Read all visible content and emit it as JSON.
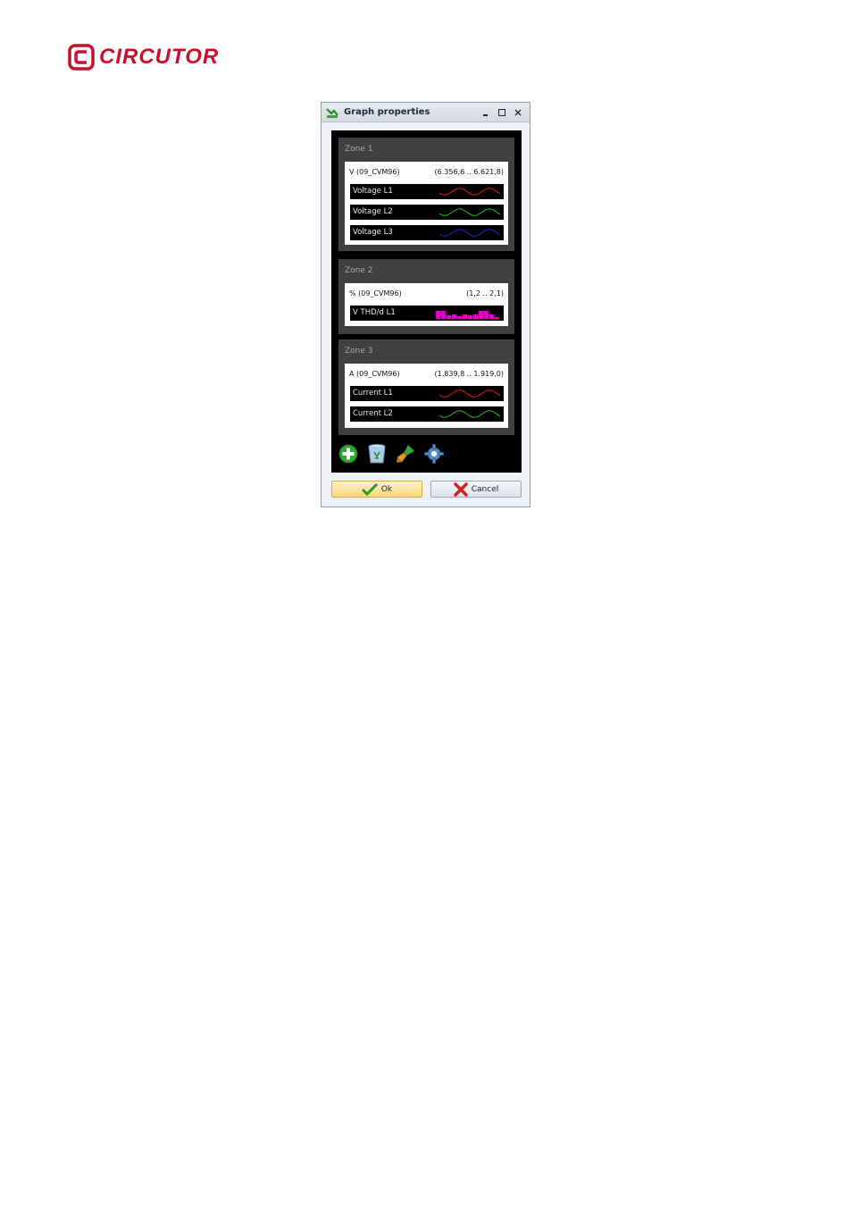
{
  "brand": {
    "name": "CIRCUTOR",
    "color": "#c8102e"
  },
  "window": {
    "title": "Graph properties",
    "minimize_icon": "minimize-icon",
    "maximize_icon": "maximize-icon",
    "close_icon": "close-icon"
  },
  "zones": [
    {
      "label": "Zone 1",
      "unit": "V (09_CVM96)",
      "range": "(6.356,6 .. 6.621,8)",
      "series": [
        {
          "name": "Voltage L1",
          "color": "#e02020",
          "style": "wave"
        },
        {
          "name": "Voltage L2",
          "color": "#20c020",
          "style": "wave"
        },
        {
          "name": "Voltage L3",
          "color": "#2020d0",
          "style": "wave"
        }
      ]
    },
    {
      "label": "Zone 2",
      "unit": "% (09_CVM96)",
      "range": "(1,2 .. 2,1)",
      "series": [
        {
          "name": "V THD/d L1",
          "color": "#e000c0",
          "style": "bars"
        }
      ]
    },
    {
      "label": "Zone 3",
      "unit": "A (09_CVM96)",
      "range": "(1.839,8 .. 1.919,0)",
      "series": [
        {
          "name": "Current L1",
          "color": "#e02020",
          "style": "wave"
        },
        {
          "name": "Current L2",
          "color": "#20c020",
          "style": "wave"
        }
      ]
    }
  ],
  "toolbar": {
    "icons": [
      "add-icon",
      "recycle-bin-icon",
      "paint-brush-icon",
      "settings-gear-icon"
    ]
  },
  "buttons": {
    "ok_label": "Ok",
    "cancel_label": "Cancel"
  }
}
